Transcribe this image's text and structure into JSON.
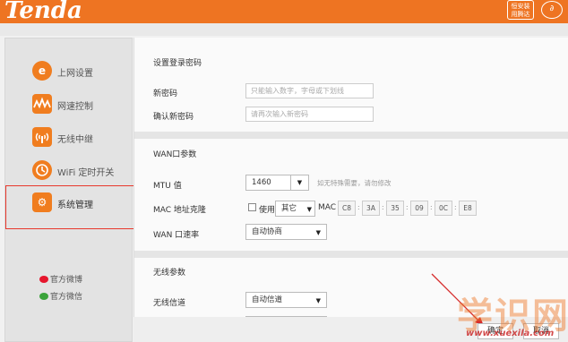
{
  "header": {
    "logo": "Tenda",
    "badge_line1": "恒安装",
    "badge_line2": "用腾达"
  },
  "sidebar": {
    "items": [
      {
        "label": "上网设置",
        "icon": "e-icon"
      },
      {
        "label": "网速控制",
        "icon": "speed-wave-icon"
      },
      {
        "label": "无线中继",
        "icon": "wireless-repeater-icon"
      },
      {
        "label": "WiFi 定时开关",
        "icon": "clock-icon"
      },
      {
        "label": "系统管理",
        "icon": "gear-icon"
      }
    ],
    "weibo": "官方微博",
    "wechat": "官方微信"
  },
  "password": {
    "title": "设置登录密码",
    "new_label": "新密码",
    "new_placeholder": "只能输入数字，字母或下划线",
    "confirm_label": "确认新密码",
    "confirm_placeholder": "请再次输入新密码"
  },
  "wan": {
    "title": "WAN口参数",
    "mtu_label": "MTU 值",
    "mtu_value": "1460",
    "mtu_hint": "如无特殊需要，请勿修改",
    "mac_label": "MAC 地址克隆",
    "mac_use": "使用",
    "mac_mode": "其它",
    "mac_prefix": "MAC",
    "mac_parts": [
      "C8",
      "3A",
      "35",
      "09",
      "0C",
      "E8"
    ],
    "speed_label": "WAN 口速率",
    "speed_value": "自动协商"
  },
  "wireless": {
    "title": "无线参数",
    "channel_label": "无线信道",
    "channel_value": "自动信道"
  },
  "buttons": {
    "ok": "确定",
    "cancel": "取消"
  },
  "watermark": {
    "text": "学识网",
    "url": "www.xuexila.com"
  },
  "colors": {
    "accent": "#ee7422",
    "highlight": "#e8382c"
  }
}
